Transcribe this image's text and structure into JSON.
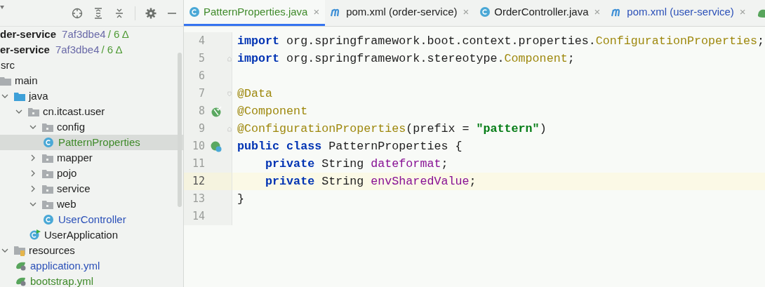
{
  "project_tool": {
    "headers": [
      {
        "name": "der-service",
        "hash": "7af3dbe4",
        "changes": "/ 6 Δ"
      },
      {
        "name": "er-service",
        "hash": "7af3dbe4",
        "changes": "/ 6 Δ"
      }
    ],
    "tree": [
      {
        "label": "src",
        "selected": false,
        "children": [
          {
            "label": "main",
            "kind": "folder",
            "selected": false,
            "children": [
              {
                "label": "java",
                "kind": "source-folder",
                "selected": false,
                "expanded": true,
                "children": [
                  {
                    "label": "cn.itcast.user",
                    "kind": "package",
                    "selected": false,
                    "expanded": true,
                    "children": [
                      {
                        "label": "config",
                        "kind": "package",
                        "selected": false,
                        "expanded": true,
                        "children": [
                          {
                            "label": "PatternProperties",
                            "kind": "class",
                            "color": "#3f8a2a",
                            "selected": true
                          }
                        ]
                      },
                      {
                        "label": "mapper",
                        "kind": "package",
                        "selected": false,
                        "expanded": false
                      },
                      {
                        "label": "pojo",
                        "kind": "package",
                        "selected": false,
                        "expanded": false
                      },
                      {
                        "label": "service",
                        "kind": "package",
                        "selected": false,
                        "expanded": false
                      },
                      {
                        "label": "web",
                        "kind": "package",
                        "selected": false,
                        "expanded": true,
                        "children": [
                          {
                            "label": "UserController",
                            "kind": "class",
                            "color": "#2b50b8",
                            "selected": false
                          }
                        ]
                      },
                      {
                        "label": "UserApplication",
                        "kind": "spring-app",
                        "selected": false
                      }
                    ]
                  }
                ]
              },
              {
                "label": "resources",
                "kind": "resources",
                "selected": false,
                "expanded": true,
                "children": [
                  {
                    "label": "application.yml",
                    "kind": "yaml",
                    "color": "#2b50b8",
                    "selected": false
                  },
                  {
                    "label": "bootstrap.yml",
                    "kind": "yaml",
                    "color": "#3f8a2a",
                    "selected": false
                  }
                ]
              }
            ]
          }
        ]
      }
    ]
  },
  "tabs": [
    {
      "label": "PatternProperties.java",
      "kind": "java",
      "color": "#3f8a2a",
      "selected": true,
      "close": "×"
    },
    {
      "label": "pom.xml (order-service)",
      "kind": "maven",
      "selected": false,
      "close": "×"
    },
    {
      "label": "OrderController.java",
      "kind": "java",
      "selected": false,
      "close": "×"
    },
    {
      "label": "pom.xml (user-service)",
      "kind": "maven",
      "color": "#2b50b8",
      "selected": false,
      "close": "×"
    }
  ],
  "editor": {
    "lines": [
      {
        "number": "4",
        "current": false,
        "tokens": [
          {
            "text": "import",
            "kind": "keyword"
          },
          {
            "text": " org.springframework.boot.context.properties.",
            "kind": "plain"
          },
          {
            "text": "ConfigurationProperties",
            "kind": "type"
          },
          {
            "text": ";",
            "kind": "plain"
          }
        ]
      },
      {
        "number": "5",
        "current": false,
        "fold": {
          "kind": "end"
        },
        "tokens": [
          {
            "text": "import",
            "kind": "keyword"
          },
          {
            "text": " org.springframework.stereotype.",
            "kind": "plain"
          },
          {
            "text": "Component",
            "kind": "type"
          },
          {
            "text": ";",
            "kind": "plain"
          }
        ]
      },
      {
        "number": "6",
        "current": false
      },
      {
        "number": "7",
        "current": false,
        "fold": {
          "kind": "start"
        },
        "tokens": [
          {
            "text": "@Data",
            "kind": "annotation"
          }
        ]
      },
      {
        "number": "8",
        "current": false,
        "marker": {
          "kind": "bean"
        },
        "tokens": [
          {
            "text": "@Component",
            "kind": "annotation"
          }
        ]
      },
      {
        "number": "9",
        "current": false,
        "fold": {
          "kind": "end"
        },
        "tokens": [
          {
            "text": "@ConfigurationProperties",
            "kind": "annotation"
          },
          {
            "text": "(prefix = ",
            "kind": "plain"
          },
          {
            "text": "\"pattern\"",
            "kind": "string"
          },
          {
            "text": ")",
            "kind": "plain"
          }
        ]
      },
      {
        "number": "10",
        "current": false,
        "marker": {
          "kind": "bean-class"
        },
        "tokens": [
          {
            "text": "public class",
            "kind": "keyword"
          },
          {
            "text": " PatternProperties {",
            "kind": "plain"
          }
        ]
      },
      {
        "number": "11",
        "current": false,
        "tokens": [
          {
            "text": "    private",
            "kind": "keyword"
          },
          {
            "text": " String ",
            "kind": "plain"
          },
          {
            "text": "dateformat",
            "kind": "field"
          },
          {
            "text": ";",
            "kind": "plain"
          }
        ]
      },
      {
        "number": "12",
        "current": true,
        "tokens": [
          {
            "text": "    private",
            "kind": "keyword"
          },
          {
            "text": " String ",
            "kind": "plain"
          },
          {
            "text": "envSharedValue",
            "kind": "field"
          },
          {
            "text": ";",
            "kind": "plain"
          }
        ]
      },
      {
        "number": "13",
        "current": false,
        "tokens": [
          {
            "text": "}",
            "kind": "plain"
          }
        ]
      },
      {
        "number": "14",
        "current": false
      }
    ]
  }
}
